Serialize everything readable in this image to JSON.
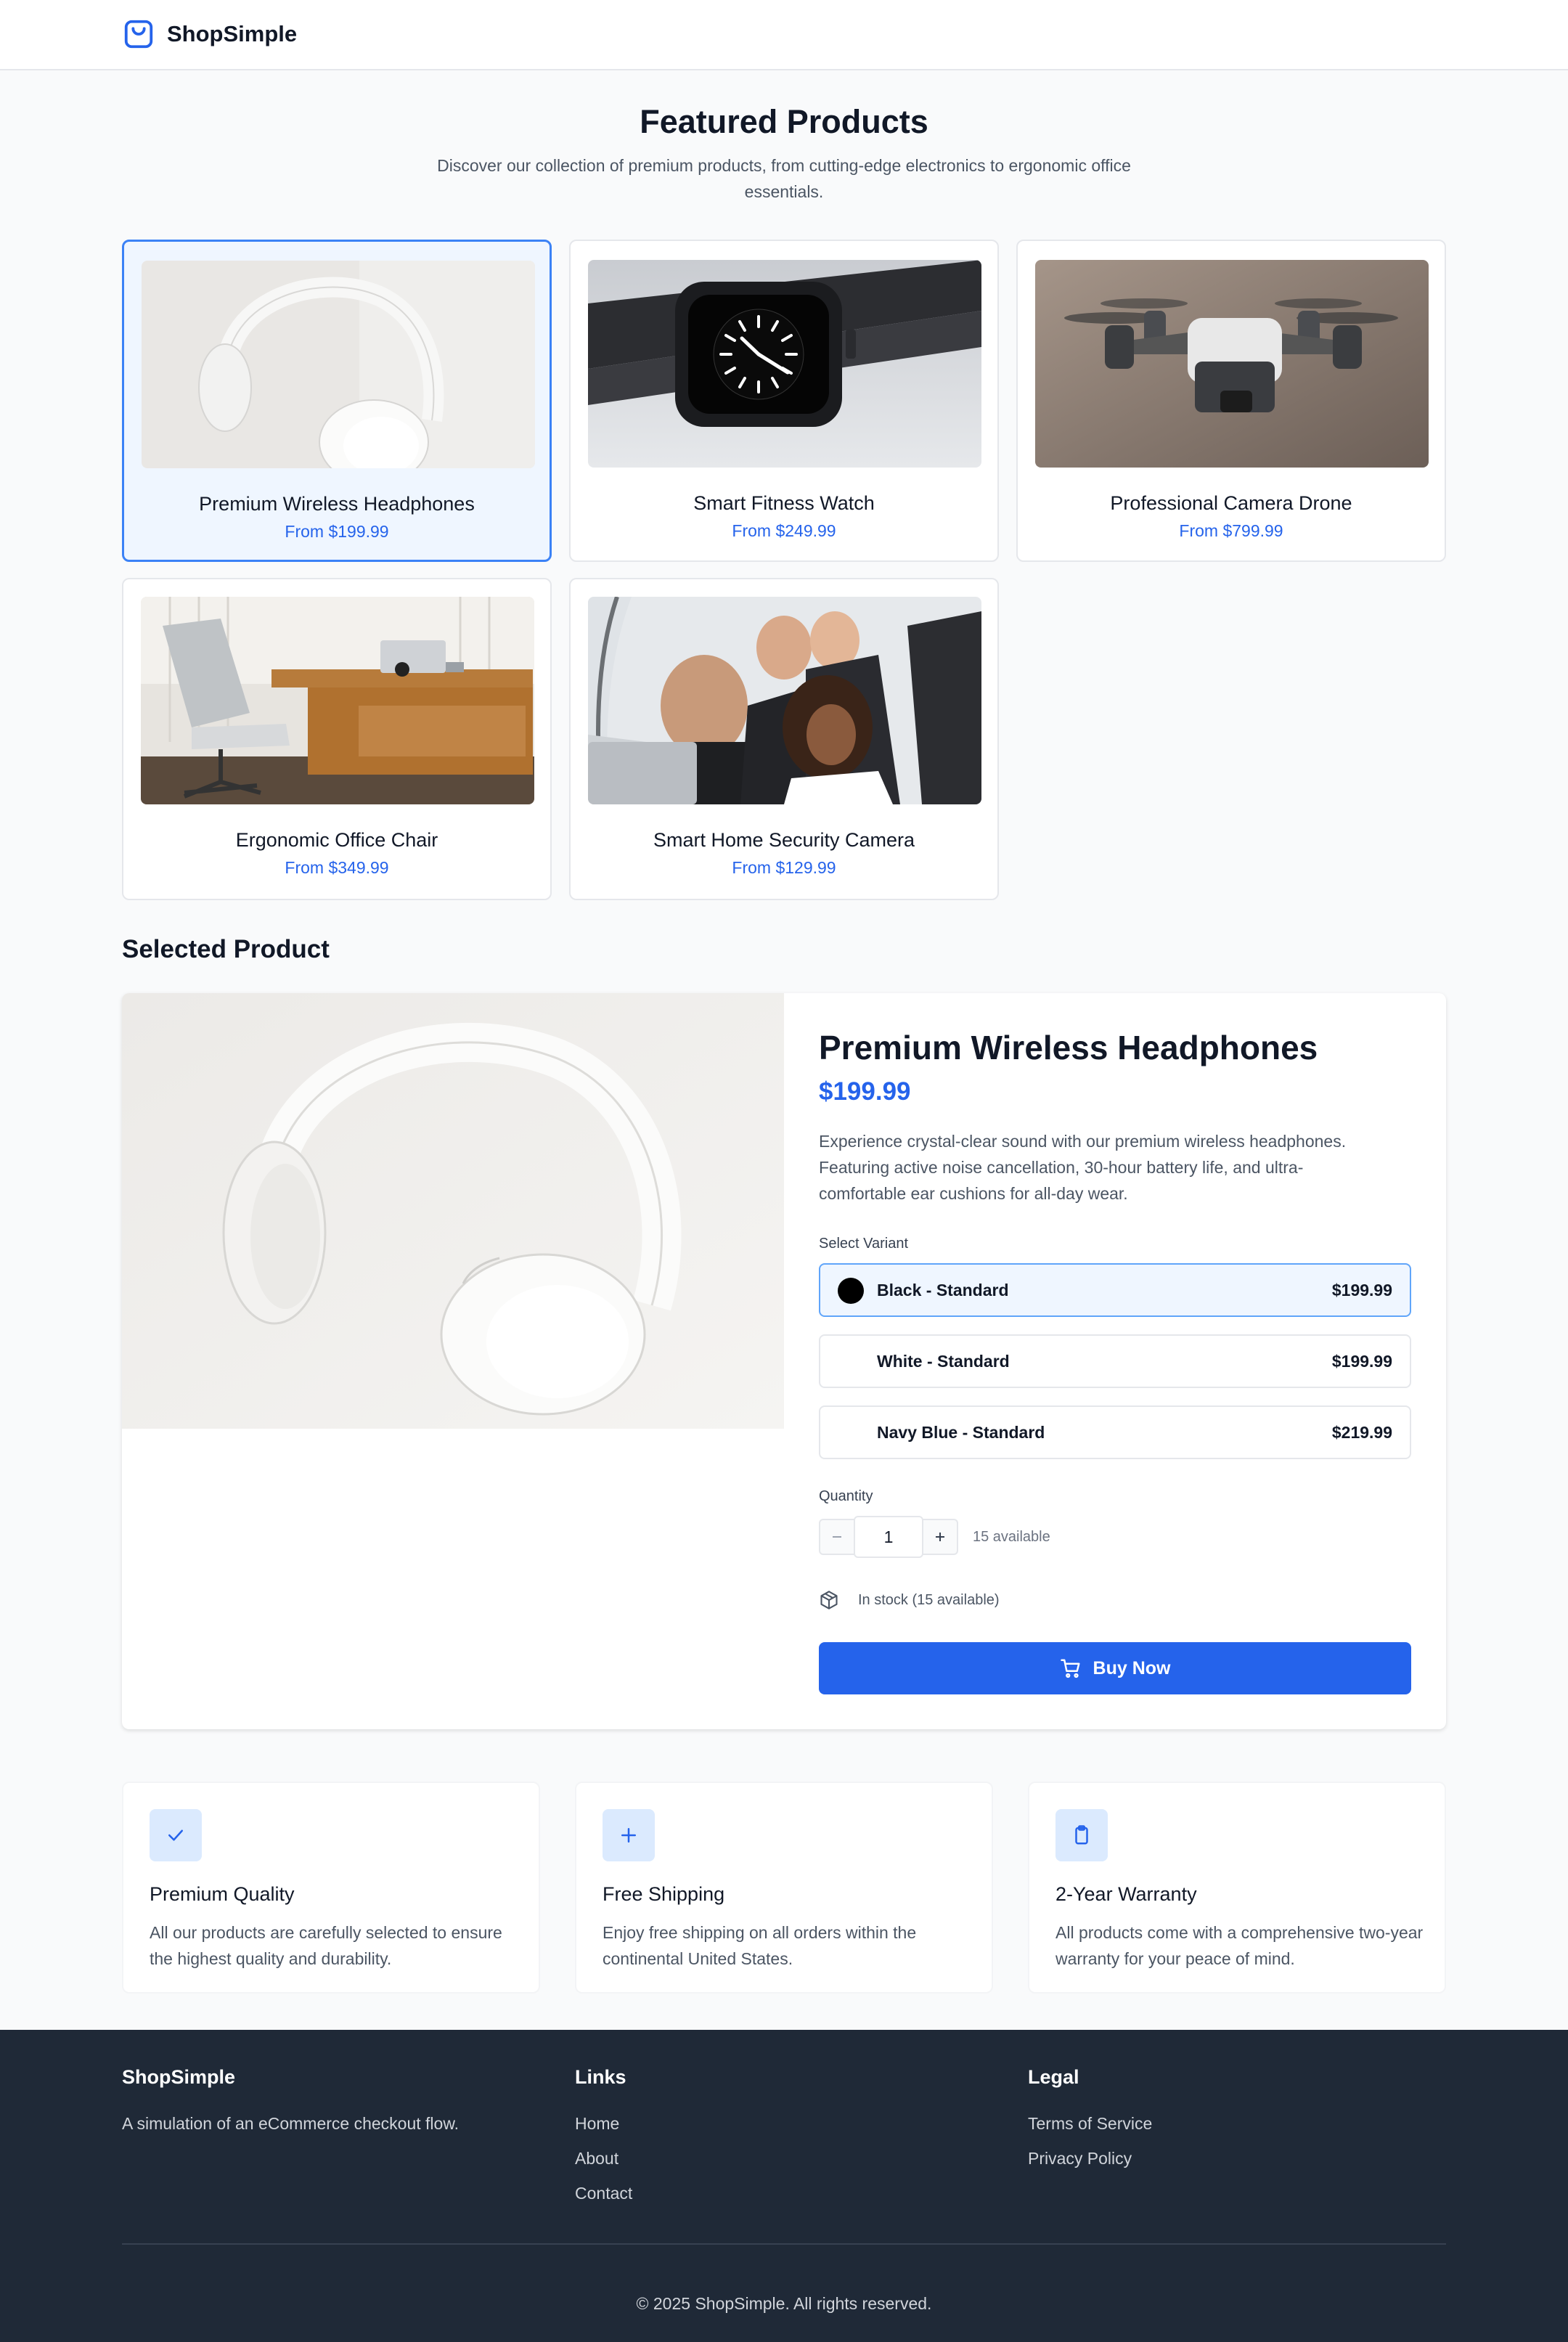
{
  "brand": {
    "name": "ShopSimple"
  },
  "hero": {
    "title": "Featured Products",
    "subtitle": "Discover our collection of premium products, from cutting-edge electronics to ergonomic office essentials."
  },
  "products": [
    {
      "name": "Premium Wireless Headphones",
      "price": "From $199.99"
    },
    {
      "name": "Smart Fitness Watch",
      "price": "From $249.99"
    },
    {
      "name": "Professional Camera Drone",
      "price": "From $799.99"
    },
    {
      "name": "Ergonomic Office Chair",
      "price": "From $349.99"
    },
    {
      "name": "Smart Home Security Camera",
      "price": "From $129.99"
    }
  ],
  "selected": {
    "section_title": "Selected Product",
    "name": "Premium Wireless Headphones",
    "price": "$199.99",
    "description": "Experience crystal-clear sound with our premium wireless headphones. Featuring active noise cancellation, 30-hour battery life, and ultra-comfortable ear cushions for all-day wear.",
    "variant_label": "Select Variant",
    "variants": [
      {
        "name": "Black - Standard",
        "price": "$199.99",
        "swatch": "#000000"
      },
      {
        "name": "White - Standard",
        "price": "$199.99",
        "swatch": "#ffffff"
      },
      {
        "name": "Navy Blue - Standard",
        "price": "$219.99",
        "swatch": "#ffffff"
      }
    ],
    "quantity_label": "Quantity",
    "quantity": "1",
    "available": "15 available",
    "stock": "In stock (15 available)",
    "buy_label": "Buy Now"
  },
  "features": [
    {
      "icon": "check-icon",
      "title": "Premium Quality",
      "desc": "All our products are carefully selected to ensure the highest quality and durability."
    },
    {
      "icon": "plus-icon",
      "title": "Free Shipping",
      "desc": "Enjoy free shipping on all orders within the continental United States."
    },
    {
      "icon": "clipboard-icon",
      "title": "2-Year Warranty",
      "desc": "All products come with a comprehensive two-year warranty for your peace of mind."
    }
  ],
  "footer": {
    "brand": "ShopSimple",
    "tagline": "A simulation of an eCommerce checkout flow.",
    "links_title": "Links",
    "links": [
      "Home",
      "About",
      "Contact"
    ],
    "legal_title": "Legal",
    "legal": [
      "Terms of Service",
      "Privacy Policy"
    ],
    "copyright": "© 2025 ShopSimple. All rights reserved."
  },
  "colors": {
    "accent": "#2563eb",
    "footer_bg": "#1f2937",
    "selected_bg": "#eff6ff"
  }
}
